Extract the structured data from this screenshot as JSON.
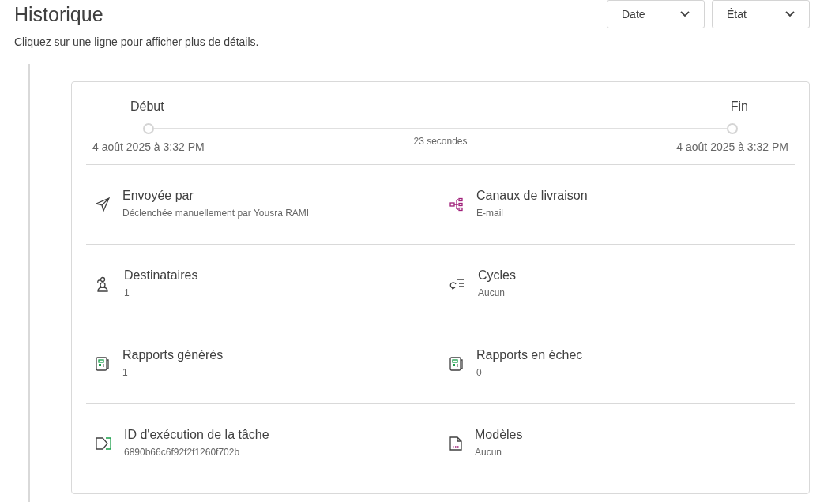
{
  "header": {
    "title": "Historique",
    "subtitle": "Cliquez sur une ligne pour afficher plus de détails."
  },
  "filters": [
    {
      "label": "Date"
    },
    {
      "label": "État"
    }
  ],
  "timeline": {
    "start_label": "Début",
    "end_label": "Fin",
    "start_time": "4 août 2025 à 3:32 PM",
    "end_time": "4 août 2025 à 3:32 PM",
    "duration": "23 secondes"
  },
  "details": [
    {
      "kind": "send",
      "label": "Envoyée par",
      "value": "Déclenchée manuellement par Yousra RAMI"
    },
    {
      "kind": "channels",
      "label": "Canaux de livraison",
      "value": "E-mail"
    },
    {
      "kind": "recipients",
      "label": "Destinataires",
      "value": "1"
    },
    {
      "kind": "cycles",
      "label": "Cycles",
      "value": "Aucun"
    },
    {
      "kind": "report",
      "label": "Rapports générés",
      "value": "1"
    },
    {
      "kind": "report",
      "label": "Rapports en échec",
      "value": "0"
    },
    {
      "kind": "taskid",
      "label": "ID d'exécution de la tâche",
      "value": "6890b66c6f92f2f1260f702b"
    },
    {
      "kind": "template",
      "label": "Modèles",
      "value": "Aucun"
    }
  ]
}
